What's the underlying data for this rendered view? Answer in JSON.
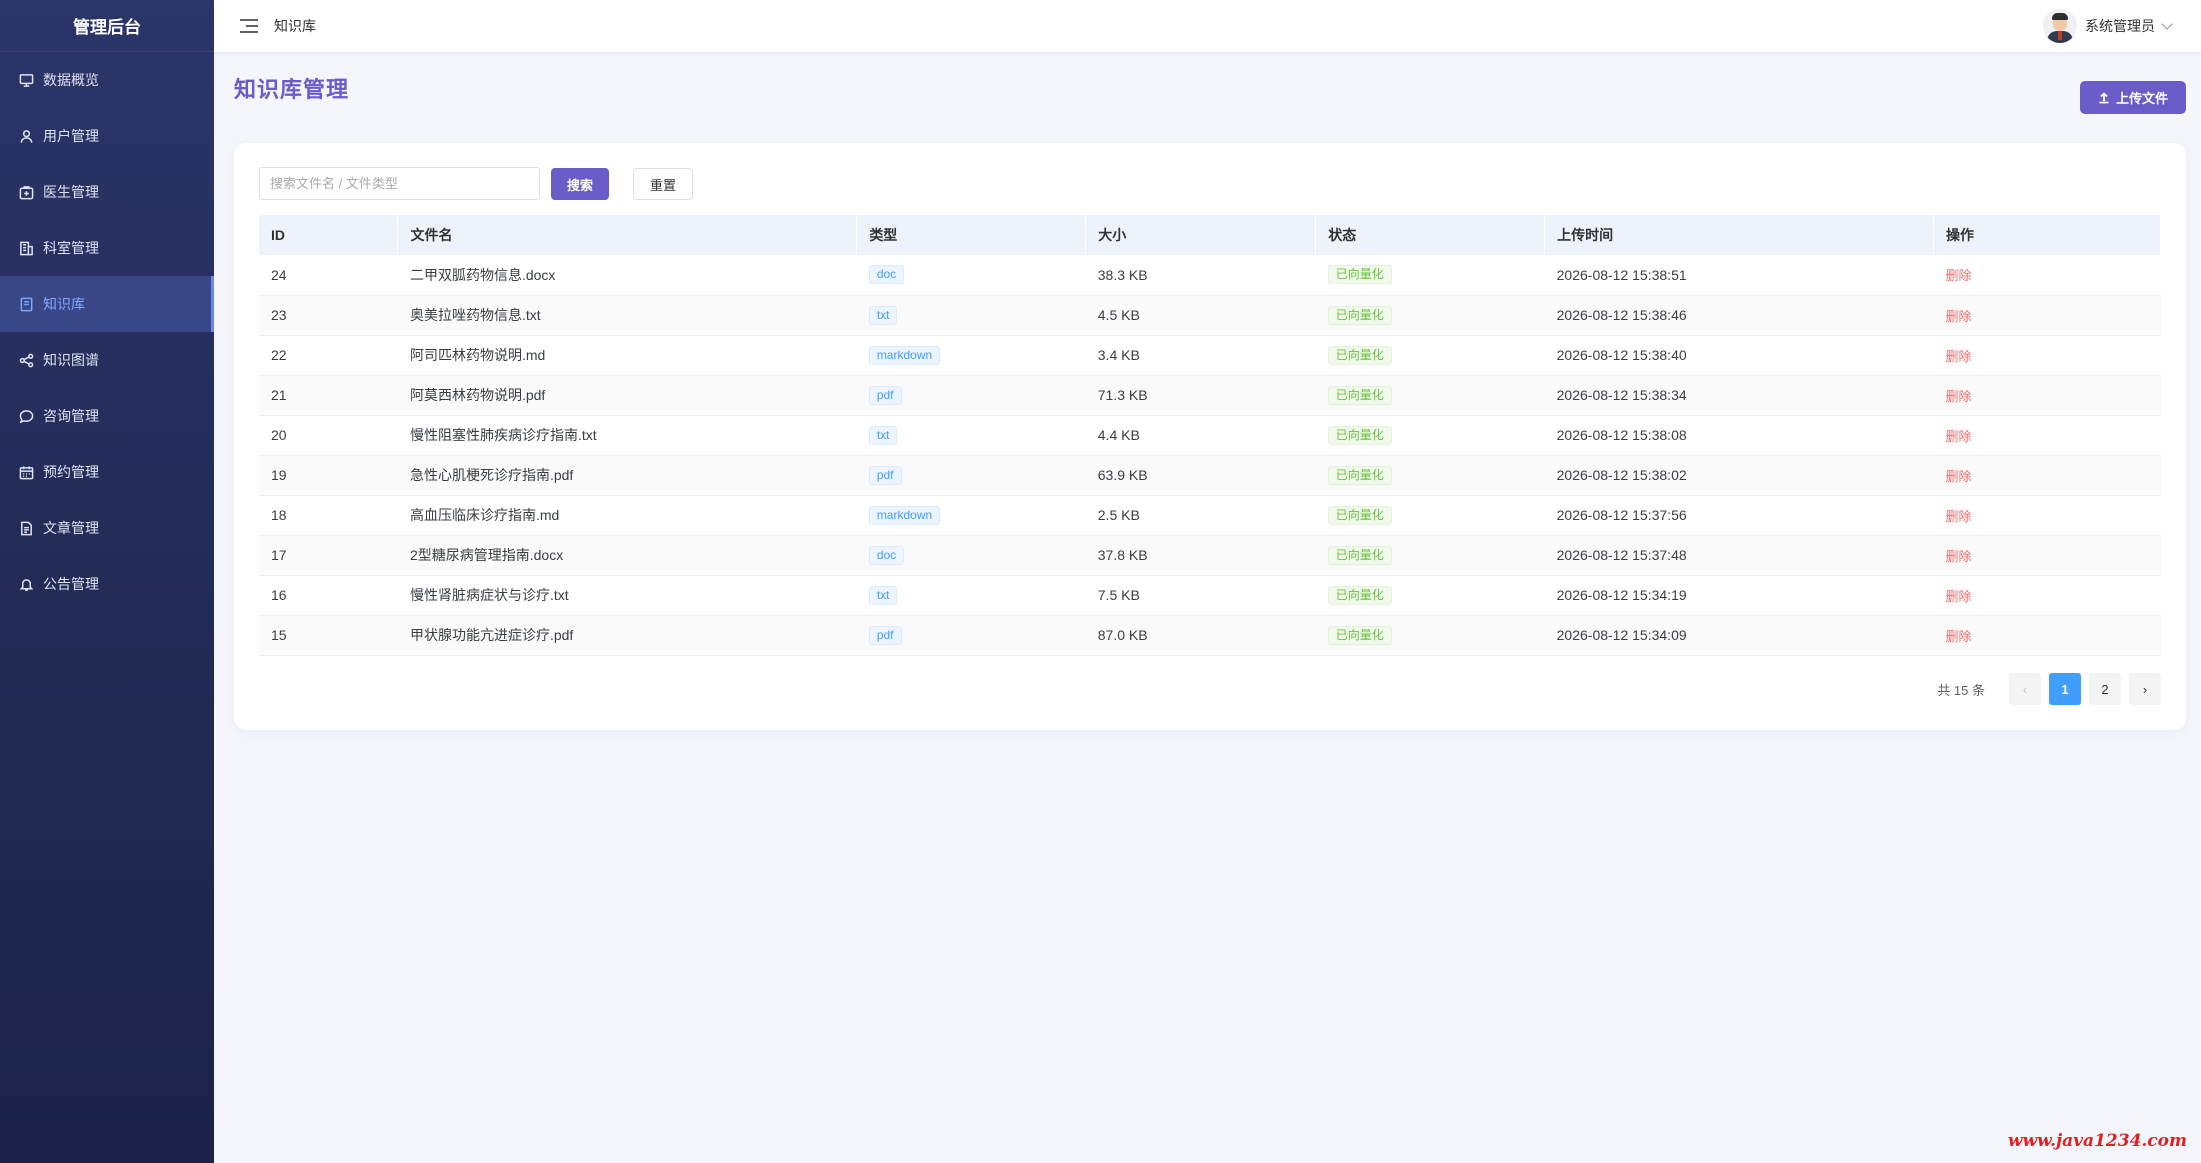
{
  "sidebar": {
    "brand": "管理后台",
    "items": [
      {
        "label": "数据概览",
        "icon": "monitor-icon"
      },
      {
        "label": "用户管理",
        "icon": "user-icon"
      },
      {
        "label": "医生管理",
        "icon": "medical-kit-icon"
      },
      {
        "label": "科室管理",
        "icon": "building-icon"
      },
      {
        "label": "知识库",
        "icon": "notebook-icon",
        "active": true
      },
      {
        "label": "知识图谱",
        "icon": "share-icon"
      },
      {
        "label": "咨询管理",
        "icon": "chat-icon"
      },
      {
        "label": "预约管理",
        "icon": "calendar-icon"
      },
      {
        "label": "文章管理",
        "icon": "document-icon"
      },
      {
        "label": "公告管理",
        "icon": "bell-icon"
      }
    ]
  },
  "header": {
    "breadcrumb": "知识库",
    "user_name": "系统管理员"
  },
  "main": {
    "title": "知识库管理",
    "upload_label": "上传文件",
    "search_placeholder": "搜索文件名 / 文件类型",
    "search_label": "搜索",
    "reset_label": "重置"
  },
  "table": {
    "columns": [
      "ID",
      "文件名",
      "类型",
      "大小",
      "状态",
      "上传时间",
      "操作"
    ],
    "rows": [
      {
        "id": "24",
        "name": "二甲双胍药物信息.docx",
        "type": "doc",
        "size": "38.3 KB",
        "status": "已向量化",
        "time": "2026-08-12 15:38:51",
        "action": "删除"
      },
      {
        "id": "23",
        "name": "奥美拉唑药物信息.txt",
        "type": "txt",
        "size": "4.5 KB",
        "status": "已向量化",
        "time": "2026-08-12 15:38:46",
        "action": "删除"
      },
      {
        "id": "22",
        "name": "阿司匹林药物说明.md",
        "type": "markdown",
        "size": "3.4 KB",
        "status": "已向量化",
        "time": "2026-08-12 15:38:40",
        "action": "删除"
      },
      {
        "id": "21",
        "name": "阿莫西林药物说明.pdf",
        "type": "pdf",
        "size": "71.3 KB",
        "status": "已向量化",
        "time": "2026-08-12 15:38:34",
        "action": "删除"
      },
      {
        "id": "20",
        "name": "慢性阻塞性肺疾病诊疗指南.txt",
        "type": "txt",
        "size": "4.4 KB",
        "status": "已向量化",
        "time": "2026-08-12 15:38:08",
        "action": "删除"
      },
      {
        "id": "19",
        "name": "急性心肌梗死诊疗指南.pdf",
        "type": "pdf",
        "size": "63.9 KB",
        "status": "已向量化",
        "time": "2026-08-12 15:38:02",
        "action": "删除"
      },
      {
        "id": "18",
        "name": "高血压临床诊疗指南.md",
        "type": "markdown",
        "size": "2.5 KB",
        "status": "已向量化",
        "time": "2026-08-12 15:37:56",
        "action": "删除"
      },
      {
        "id": "17",
        "name": "2型糖尿病管理指南.docx",
        "type": "doc",
        "size": "37.8 KB",
        "status": "已向量化",
        "time": "2026-08-12 15:37:48",
        "action": "删除"
      },
      {
        "id": "16",
        "name": "慢性肾脏病症状与诊疗.txt",
        "type": "txt",
        "size": "7.5 KB",
        "status": "已向量化",
        "time": "2026-08-12 15:34:19",
        "action": "删除"
      },
      {
        "id": "15",
        "name": "甲状腺功能亢进症诊疗.pdf",
        "type": "pdf",
        "size": "87.0 KB",
        "status": "已向量化",
        "time": "2026-08-12 15:34:09",
        "action": "删除"
      }
    ]
  },
  "pagination": {
    "total": "共 15 条",
    "prev": "‹",
    "pages": [
      "1",
      "2"
    ],
    "next": "›"
  },
  "watermark": "www.java1234.com"
}
